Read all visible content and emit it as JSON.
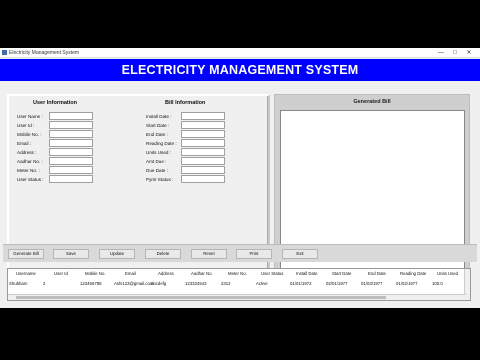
{
  "window": {
    "title": "Electricity Management System",
    "minimize": "—",
    "maximize": "□",
    "close": "✕"
  },
  "header": {
    "title": "ELECTRICITY MANAGEMENT SYSTEM"
  },
  "user_info": {
    "heading": "User Information",
    "fields": [
      "User Name :",
      "User Id :",
      "Mobile No. :",
      "Email :",
      "Address :",
      "Aadhar No. :",
      "Meter No. :",
      "User Status :"
    ]
  },
  "bill_info": {
    "heading": "Bill Information",
    "fields": [
      "Install Date :",
      "Start Date :",
      "End Date :",
      "Reading Date :",
      "Units Used :",
      "Amt Due :",
      "Due Date :",
      "Pymt Status :"
    ]
  },
  "generated_bill": {
    "heading": "Generated Bill"
  },
  "buttons": [
    "Generate Bill",
    "Save",
    "Update",
    "Delete",
    "Reset",
    "Print",
    "Exit"
  ],
  "table": {
    "columns": [
      "Username",
      "User Id",
      "Mobile No.",
      "Email",
      "Address",
      "Aadhar No.",
      "Meter No.",
      "User Status",
      "Install Date",
      "Start Date",
      "End Date",
      "Reading Date",
      "Units Used"
    ],
    "rows": [
      [
        "Shubham",
        "2",
        "123456788",
        "Ashi123@gmail.com",
        "abcdefg",
        "123334543",
        "2312",
        "Active",
        "01/01/1972",
        "02/01/1977",
        "01/03/1977",
        "01/02/1977",
        "100.0"
      ]
    ]
  }
}
